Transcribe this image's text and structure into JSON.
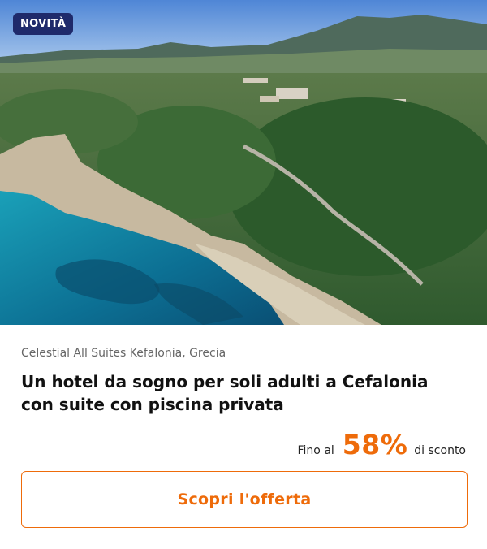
{
  "badge": {
    "label": "NOVITÀ"
  },
  "hero": {
    "image_subject": "aerial-coast-photo"
  },
  "offer": {
    "location": "Celestial All Suites Kefalonia, Grecia",
    "title": "Un hotel da sogno per soli adulti a Cefalonia con suite con piscina privata",
    "discount_prefix": "Fino al",
    "discount_value": "58%",
    "discount_suffix": "di sconto",
    "cta_label": "Scopri l'offerta"
  },
  "colors": {
    "accent": "#ee6b0a",
    "badge_bg": "#1f2a6b",
    "text": "#111111",
    "muted": "#666666"
  }
}
